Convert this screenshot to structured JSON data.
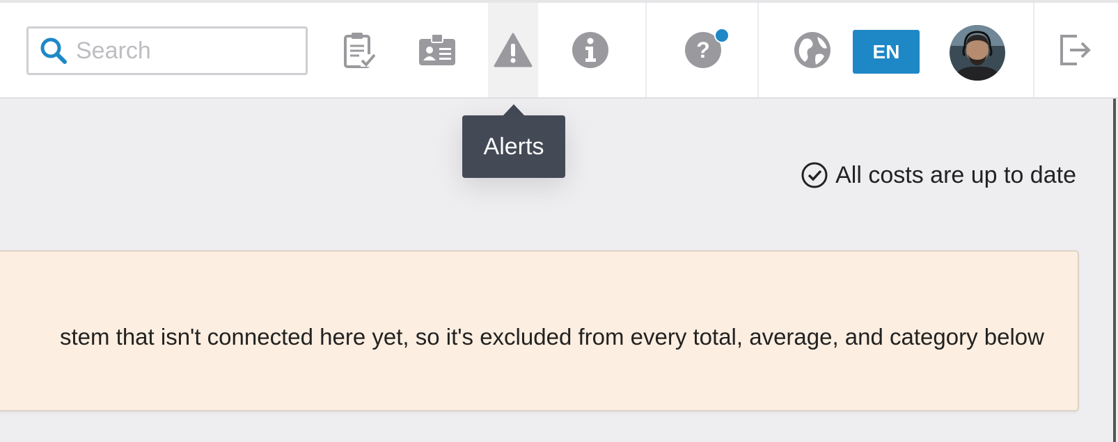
{
  "search": {
    "placeholder": "Search",
    "value": ""
  },
  "header": {
    "icons": [
      {
        "name": "tasks-checklist-icon"
      },
      {
        "name": "id-card-icon"
      },
      {
        "name": "alert-warning-icon",
        "active": true
      },
      {
        "name": "info-icon"
      },
      {
        "name": "help-icon",
        "has_notification": true
      },
      {
        "name": "globe-icon"
      }
    ],
    "language": "EN",
    "accent_color": "#1e88c7"
  },
  "tooltip": {
    "text": "Alerts"
  },
  "status": {
    "text": "All costs are up to date"
  },
  "banner": {
    "text": "stem that isn't connected here yet, so it's excluded from every total, average, and category below",
    "background": "#fceee0"
  }
}
